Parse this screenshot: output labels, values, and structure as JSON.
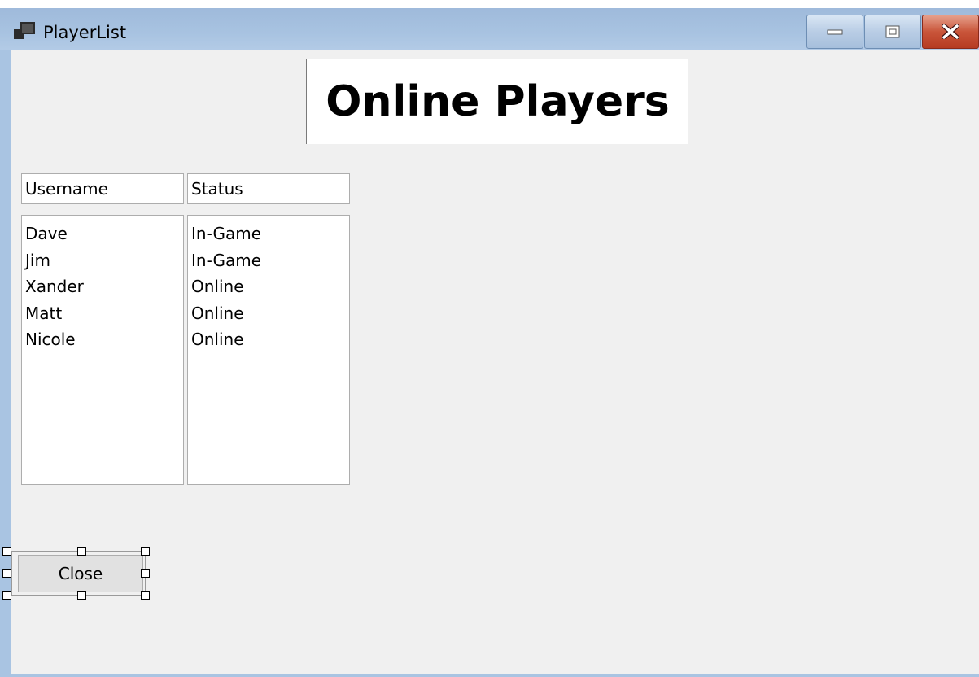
{
  "window": {
    "title": "PlayerList",
    "controls": {
      "minimize": "minimize-icon",
      "maximize": "maximize-icon",
      "close": "close-icon"
    }
  },
  "heading": "Online Players",
  "columns": {
    "username": "Username",
    "status": "Status"
  },
  "players": [
    {
      "username": "Dave",
      "status": "In-Game"
    },
    {
      "username": "Jim",
      "status": "In-Game"
    },
    {
      "username": "Xander",
      "status": "Online"
    },
    {
      "username": "Matt",
      "status": "Online"
    },
    {
      "username": "Nicole",
      "status": "Online"
    }
  ],
  "close_button": "Close",
  "colors": {
    "titlebar": "#a8c3e1",
    "client_bg": "#f0f0f0",
    "close_accent": "#c9553a"
  }
}
